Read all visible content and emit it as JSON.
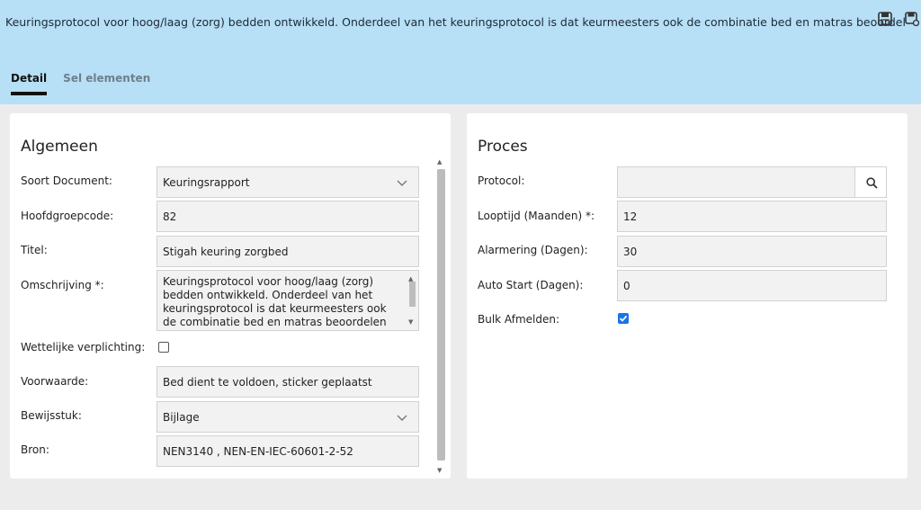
{
  "header": {
    "title": "Keuringsprotocol voor hoog/laag (zorg) bedden ontwikkeld. Onderdeel van het keuringsprotocol is dat keurmeesters ook de combinatie bed en matras beoordelen op veiligheid",
    "icons": [
      "save-icon",
      "save-as-icon"
    ]
  },
  "tabs": [
    {
      "label": "Detail",
      "active": true
    },
    {
      "label": "Sel elementen",
      "active": false
    }
  ],
  "algemeen": {
    "title": "Algemeen",
    "soort_document": {
      "label": "Soort Document:",
      "value": "Keuringsrapport"
    },
    "hoofdgroepcode": {
      "label": "Hoofdgroepcode:",
      "value": "82"
    },
    "titel": {
      "label": "Titel:",
      "value": "Stigah keuring zorgbed"
    },
    "omschrijving": {
      "label": "Omschrijving *:",
      "value": "Keuringsprotocol voor hoog/laag (zorg) bedden ontwikkeld. Onderdeel van het keuringsprotocol is dat keurmeesters ook de combinatie bed en matras beoordelen op"
    },
    "wettelijke": {
      "label": "Wettelijke verplichting:",
      "checked": false
    },
    "voorwaarde": {
      "label": "Voorwaarde:",
      "value": "Bed dient te voldoen, sticker geplaatst"
    },
    "bewijsstuk": {
      "label": "Bewijsstuk:",
      "value": "Bijlage"
    },
    "bron": {
      "label": "Bron:",
      "value": "NEN3140 , NEN-EN-IEC-60601-2-52"
    }
  },
  "proces": {
    "title": "Proces",
    "protocol": {
      "label": "Protocol:",
      "value": ""
    },
    "looptijd": {
      "label": "Looptijd (Maanden) *:",
      "value": "12"
    },
    "alarmering": {
      "label": "Alarmering (Dagen):",
      "value": "30"
    },
    "auto_start": {
      "label": "Auto Start (Dagen):",
      "value": "0"
    },
    "bulk_afmelden": {
      "label": "Bulk Afmelden:",
      "checked": true
    }
  },
  "colors": {
    "header_bg": "#b7dff6",
    "accent": "#1a73e8",
    "content_bg": "#ececec"
  }
}
